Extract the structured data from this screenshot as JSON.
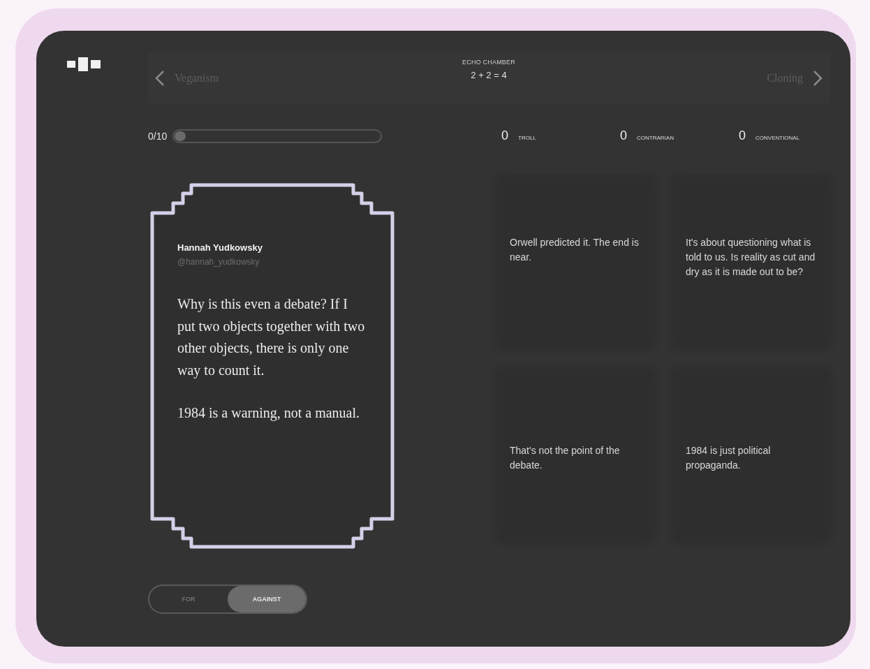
{
  "nav": {
    "previous": "Veganism",
    "next": "Cloning",
    "title": "ECHO CHAMBER",
    "subtitle": "2 + 2 = 4"
  },
  "progress": {
    "label": "0/10",
    "level": 0.03
  },
  "scores": [
    {
      "value": "0",
      "label": "TROLL"
    },
    {
      "value": "0",
      "label": "CONTRARIAN"
    },
    {
      "value": "0",
      "label": "CONVENTIONAL"
    }
  ],
  "post": {
    "author": "Hannah Yudkowsky",
    "handle": "@hannah_yudkowsky",
    "paragraphs": [
      "Why is this even a debate? If I put two objects together with two other objects, there is only one way to count it.",
      "1984 is a warning, not a manual."
    ]
  },
  "responses": [
    {
      "text": "Orwell predicted it. The end is near.",
      "kind": "top"
    },
    {
      "text": "It's about questioning what is told to us. Is reality as cut and dry as it is made out to be?",
      "kind": "top"
    },
    {
      "text": "That's not the point of the debate.",
      "kind": "bottom"
    },
    {
      "text": "1984 is just political propaganda.",
      "kind": "bottom"
    }
  ],
  "stance": [
    {
      "label": "FOR",
      "selected": false
    },
    {
      "label": "AGAINST",
      "selected": true
    }
  ]
}
